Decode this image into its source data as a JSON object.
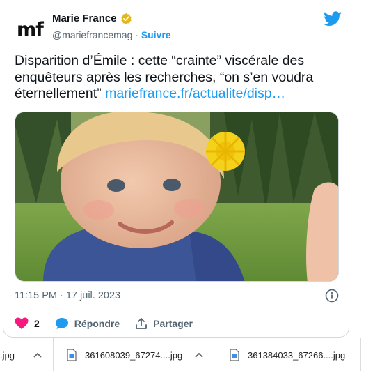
{
  "tweet": {
    "avatar_text": "mf",
    "author_name": "Marie France",
    "author_handle": "@mariefrancemag",
    "separator": " · ",
    "follow_label": "Suivre",
    "text": "Disparition d’Émile : cette “crainte” viscérale des enquêteurs après les recherches, “on s’en voudra éternellement” ",
    "link_text": "mariefrance.fr/actualite/disp…",
    "timestamp": "11:15 PM · 17 juil. 2023",
    "likes_count": "2",
    "reply_label": "Répondre",
    "share_label": "Partager"
  },
  "icons": {
    "verified": "verified-badge-icon",
    "twitter": "twitter-bird-icon",
    "info": "info-icon",
    "like": "heart-icon",
    "reply": "speech-bubble-icon",
    "share": "share-icon"
  },
  "colors": {
    "accent": "#1d9bf0",
    "like": "#f91880",
    "verified_gold": "#e2b719",
    "text": "#0f1419",
    "muted": "#536471"
  },
  "downloads": [
    {
      "name": ".jpg"
    },
    {
      "name": "361608039_67274....jpg"
    },
    {
      "name": "361384033_67266....jpg"
    }
  ]
}
